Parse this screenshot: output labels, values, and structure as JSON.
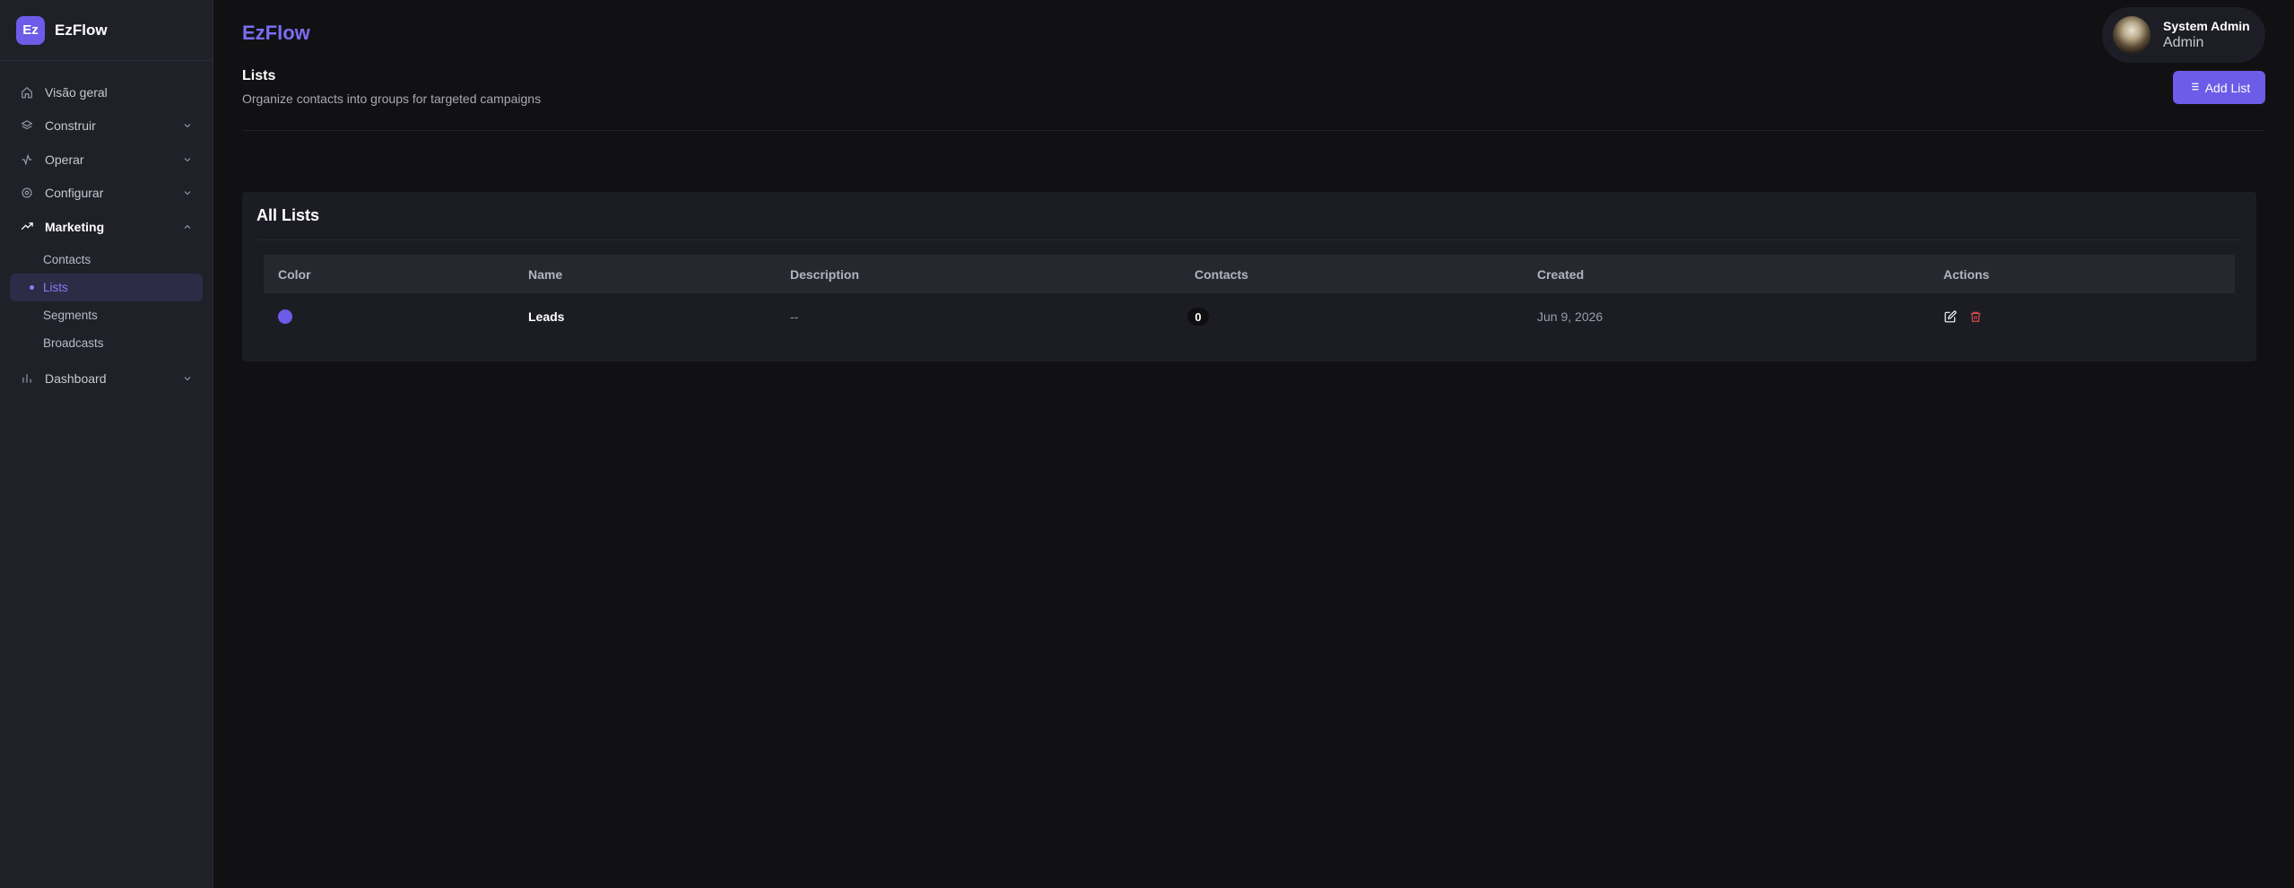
{
  "sidebar": {
    "brand_logo": "Ez",
    "brand_name": "EzFlow",
    "items": [
      {
        "label": "Visão geral",
        "icon": "home-icon"
      },
      {
        "label": "Construir",
        "icon": "layers-icon"
      },
      {
        "label": "Operar",
        "icon": "activity-icon"
      },
      {
        "label": "Configurar",
        "icon": "gear-icon"
      },
      {
        "label": "Marketing",
        "icon": "trending-up-icon"
      },
      {
        "label": "Dashboard",
        "icon": "bar-chart-icon"
      }
    ],
    "marketing_sub": [
      "Contacts",
      "Lists",
      "Segments",
      "Broadcasts"
    ]
  },
  "header": {
    "app_title": "EzFlow",
    "user_name": "System Admin",
    "user_role": "Admin"
  },
  "page": {
    "title": "Lists",
    "subtitle": "Organize contacts into groups for targeted campaigns",
    "add_button": "Add List"
  },
  "card": {
    "title": "All Lists",
    "columns": [
      "Color",
      "Name",
      "Description",
      "Contacts",
      "Created",
      "Actions"
    ],
    "rows": [
      {
        "color": "#6d5ce8",
        "name": "Leads",
        "description": "--",
        "contacts": "0",
        "created": "Jun 9, 2026"
      }
    ]
  },
  "colors": {
    "accent": "#6d5ce8",
    "danger": "#dc4c4c",
    "background": "#111114",
    "sidebar": "#1f2028"
  }
}
